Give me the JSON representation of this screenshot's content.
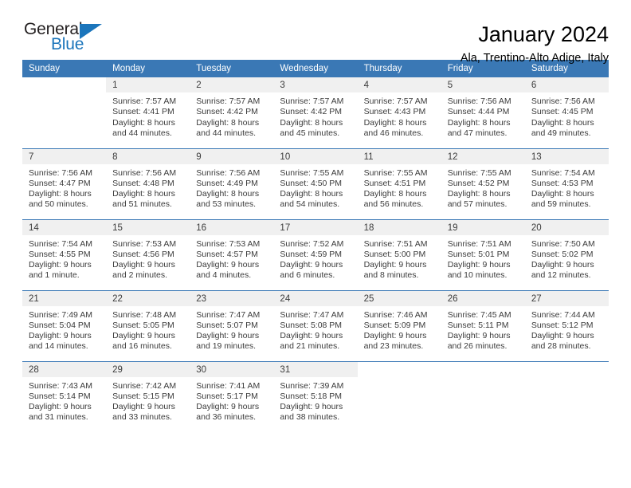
{
  "brand": {
    "top_text": "General",
    "bottom_text": "Blue",
    "accent_color": "#1b75bb"
  },
  "header": {
    "title": "January 2024",
    "subtitle": "Ala, Trentino-Alto Adige, Italy"
  },
  "theme": {
    "header_bar": "#3a78b5",
    "daynum_bg": "#f0f0f0",
    "text": "#3b3b3b"
  },
  "calendar": {
    "day_headers": [
      "Sunday",
      "Monday",
      "Tuesday",
      "Wednesday",
      "Thursday",
      "Friday",
      "Saturday"
    ],
    "weeks": [
      [
        {
          "day": "",
          "lines": []
        },
        {
          "day": "1",
          "lines": [
            "Sunrise: 7:57 AM",
            "Sunset: 4:41 PM",
            "Daylight: 8 hours",
            "and 44 minutes."
          ]
        },
        {
          "day": "2",
          "lines": [
            "Sunrise: 7:57 AM",
            "Sunset: 4:42 PM",
            "Daylight: 8 hours",
            "and 44 minutes."
          ]
        },
        {
          "day": "3",
          "lines": [
            "Sunrise: 7:57 AM",
            "Sunset: 4:42 PM",
            "Daylight: 8 hours",
            "and 45 minutes."
          ]
        },
        {
          "day": "4",
          "lines": [
            "Sunrise: 7:57 AM",
            "Sunset: 4:43 PM",
            "Daylight: 8 hours",
            "and 46 minutes."
          ]
        },
        {
          "day": "5",
          "lines": [
            "Sunrise: 7:56 AM",
            "Sunset: 4:44 PM",
            "Daylight: 8 hours",
            "and 47 minutes."
          ]
        },
        {
          "day": "6",
          "lines": [
            "Sunrise: 7:56 AM",
            "Sunset: 4:45 PM",
            "Daylight: 8 hours",
            "and 49 minutes."
          ]
        }
      ],
      [
        {
          "day": "7",
          "lines": [
            "Sunrise: 7:56 AM",
            "Sunset: 4:47 PM",
            "Daylight: 8 hours",
            "and 50 minutes."
          ]
        },
        {
          "day": "8",
          "lines": [
            "Sunrise: 7:56 AM",
            "Sunset: 4:48 PM",
            "Daylight: 8 hours",
            "and 51 minutes."
          ]
        },
        {
          "day": "9",
          "lines": [
            "Sunrise: 7:56 AM",
            "Sunset: 4:49 PM",
            "Daylight: 8 hours",
            "and 53 minutes."
          ]
        },
        {
          "day": "10",
          "lines": [
            "Sunrise: 7:55 AM",
            "Sunset: 4:50 PM",
            "Daylight: 8 hours",
            "and 54 minutes."
          ]
        },
        {
          "day": "11",
          "lines": [
            "Sunrise: 7:55 AM",
            "Sunset: 4:51 PM",
            "Daylight: 8 hours",
            "and 56 minutes."
          ]
        },
        {
          "day": "12",
          "lines": [
            "Sunrise: 7:55 AM",
            "Sunset: 4:52 PM",
            "Daylight: 8 hours",
            "and 57 minutes."
          ]
        },
        {
          "day": "13",
          "lines": [
            "Sunrise: 7:54 AM",
            "Sunset: 4:53 PM",
            "Daylight: 8 hours",
            "and 59 minutes."
          ]
        }
      ],
      [
        {
          "day": "14",
          "lines": [
            "Sunrise: 7:54 AM",
            "Sunset: 4:55 PM",
            "Daylight: 9 hours",
            "and 1 minute."
          ]
        },
        {
          "day": "15",
          "lines": [
            "Sunrise: 7:53 AM",
            "Sunset: 4:56 PM",
            "Daylight: 9 hours",
            "and 2 minutes."
          ]
        },
        {
          "day": "16",
          "lines": [
            "Sunrise: 7:53 AM",
            "Sunset: 4:57 PM",
            "Daylight: 9 hours",
            "and 4 minutes."
          ]
        },
        {
          "day": "17",
          "lines": [
            "Sunrise: 7:52 AM",
            "Sunset: 4:59 PM",
            "Daylight: 9 hours",
            "and 6 minutes."
          ]
        },
        {
          "day": "18",
          "lines": [
            "Sunrise: 7:51 AM",
            "Sunset: 5:00 PM",
            "Daylight: 9 hours",
            "and 8 minutes."
          ]
        },
        {
          "day": "19",
          "lines": [
            "Sunrise: 7:51 AM",
            "Sunset: 5:01 PM",
            "Daylight: 9 hours",
            "and 10 minutes."
          ]
        },
        {
          "day": "20",
          "lines": [
            "Sunrise: 7:50 AM",
            "Sunset: 5:02 PM",
            "Daylight: 9 hours",
            "and 12 minutes."
          ]
        }
      ],
      [
        {
          "day": "21",
          "lines": [
            "Sunrise: 7:49 AM",
            "Sunset: 5:04 PM",
            "Daylight: 9 hours",
            "and 14 minutes."
          ]
        },
        {
          "day": "22",
          "lines": [
            "Sunrise: 7:48 AM",
            "Sunset: 5:05 PM",
            "Daylight: 9 hours",
            "and 16 minutes."
          ]
        },
        {
          "day": "23",
          "lines": [
            "Sunrise: 7:47 AM",
            "Sunset: 5:07 PM",
            "Daylight: 9 hours",
            "and 19 minutes."
          ]
        },
        {
          "day": "24",
          "lines": [
            "Sunrise: 7:47 AM",
            "Sunset: 5:08 PM",
            "Daylight: 9 hours",
            "and 21 minutes."
          ]
        },
        {
          "day": "25",
          "lines": [
            "Sunrise: 7:46 AM",
            "Sunset: 5:09 PM",
            "Daylight: 9 hours",
            "and 23 minutes."
          ]
        },
        {
          "day": "26",
          "lines": [
            "Sunrise: 7:45 AM",
            "Sunset: 5:11 PM",
            "Daylight: 9 hours",
            "and 26 minutes."
          ]
        },
        {
          "day": "27",
          "lines": [
            "Sunrise: 7:44 AM",
            "Sunset: 5:12 PM",
            "Daylight: 9 hours",
            "and 28 minutes."
          ]
        }
      ],
      [
        {
          "day": "28",
          "lines": [
            "Sunrise: 7:43 AM",
            "Sunset: 5:14 PM",
            "Daylight: 9 hours",
            "and 31 minutes."
          ]
        },
        {
          "day": "29",
          "lines": [
            "Sunrise: 7:42 AM",
            "Sunset: 5:15 PM",
            "Daylight: 9 hours",
            "and 33 minutes."
          ]
        },
        {
          "day": "30",
          "lines": [
            "Sunrise: 7:41 AM",
            "Sunset: 5:17 PM",
            "Daylight: 9 hours",
            "and 36 minutes."
          ]
        },
        {
          "day": "31",
          "lines": [
            "Sunrise: 7:39 AM",
            "Sunset: 5:18 PM",
            "Daylight: 9 hours",
            "and 38 minutes."
          ]
        },
        {
          "day": "",
          "lines": []
        },
        {
          "day": "",
          "lines": []
        },
        {
          "day": "",
          "lines": []
        }
      ]
    ]
  }
}
